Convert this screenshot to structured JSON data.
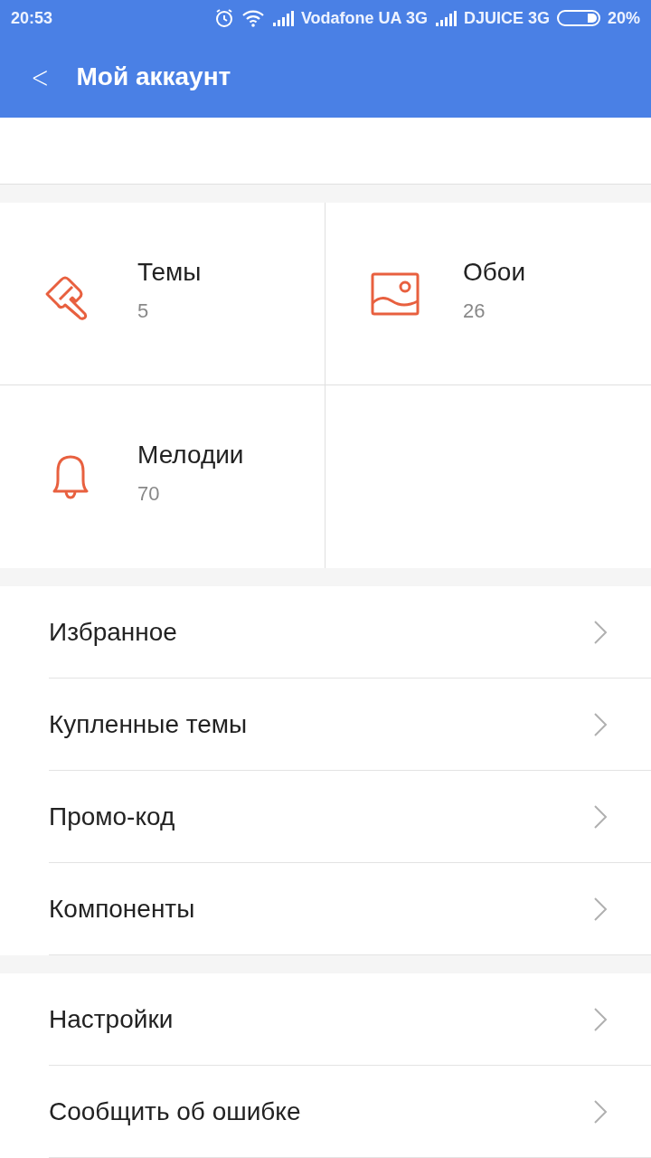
{
  "status_bar": {
    "time": "20:53",
    "carrier_1": "Vodafone UA 3G",
    "carrier_2": "DJUICE 3G",
    "battery": "20%"
  },
  "app_bar": {
    "back": "<",
    "title": "Мой аккаунт"
  },
  "tiles": [
    {
      "label": "Темы",
      "count": "5"
    },
    {
      "label": "Обои",
      "count": "26"
    },
    {
      "label": "Мелодии",
      "count": "70"
    }
  ],
  "menu_groups": [
    [
      {
        "label": "Избранное"
      },
      {
        "label": "Купленные темы"
      },
      {
        "label": "Промо-код"
      },
      {
        "label": "Компоненты"
      }
    ],
    [
      {
        "label": "Настройки"
      },
      {
        "label": "Сообщить об ошибке"
      }
    ]
  ]
}
